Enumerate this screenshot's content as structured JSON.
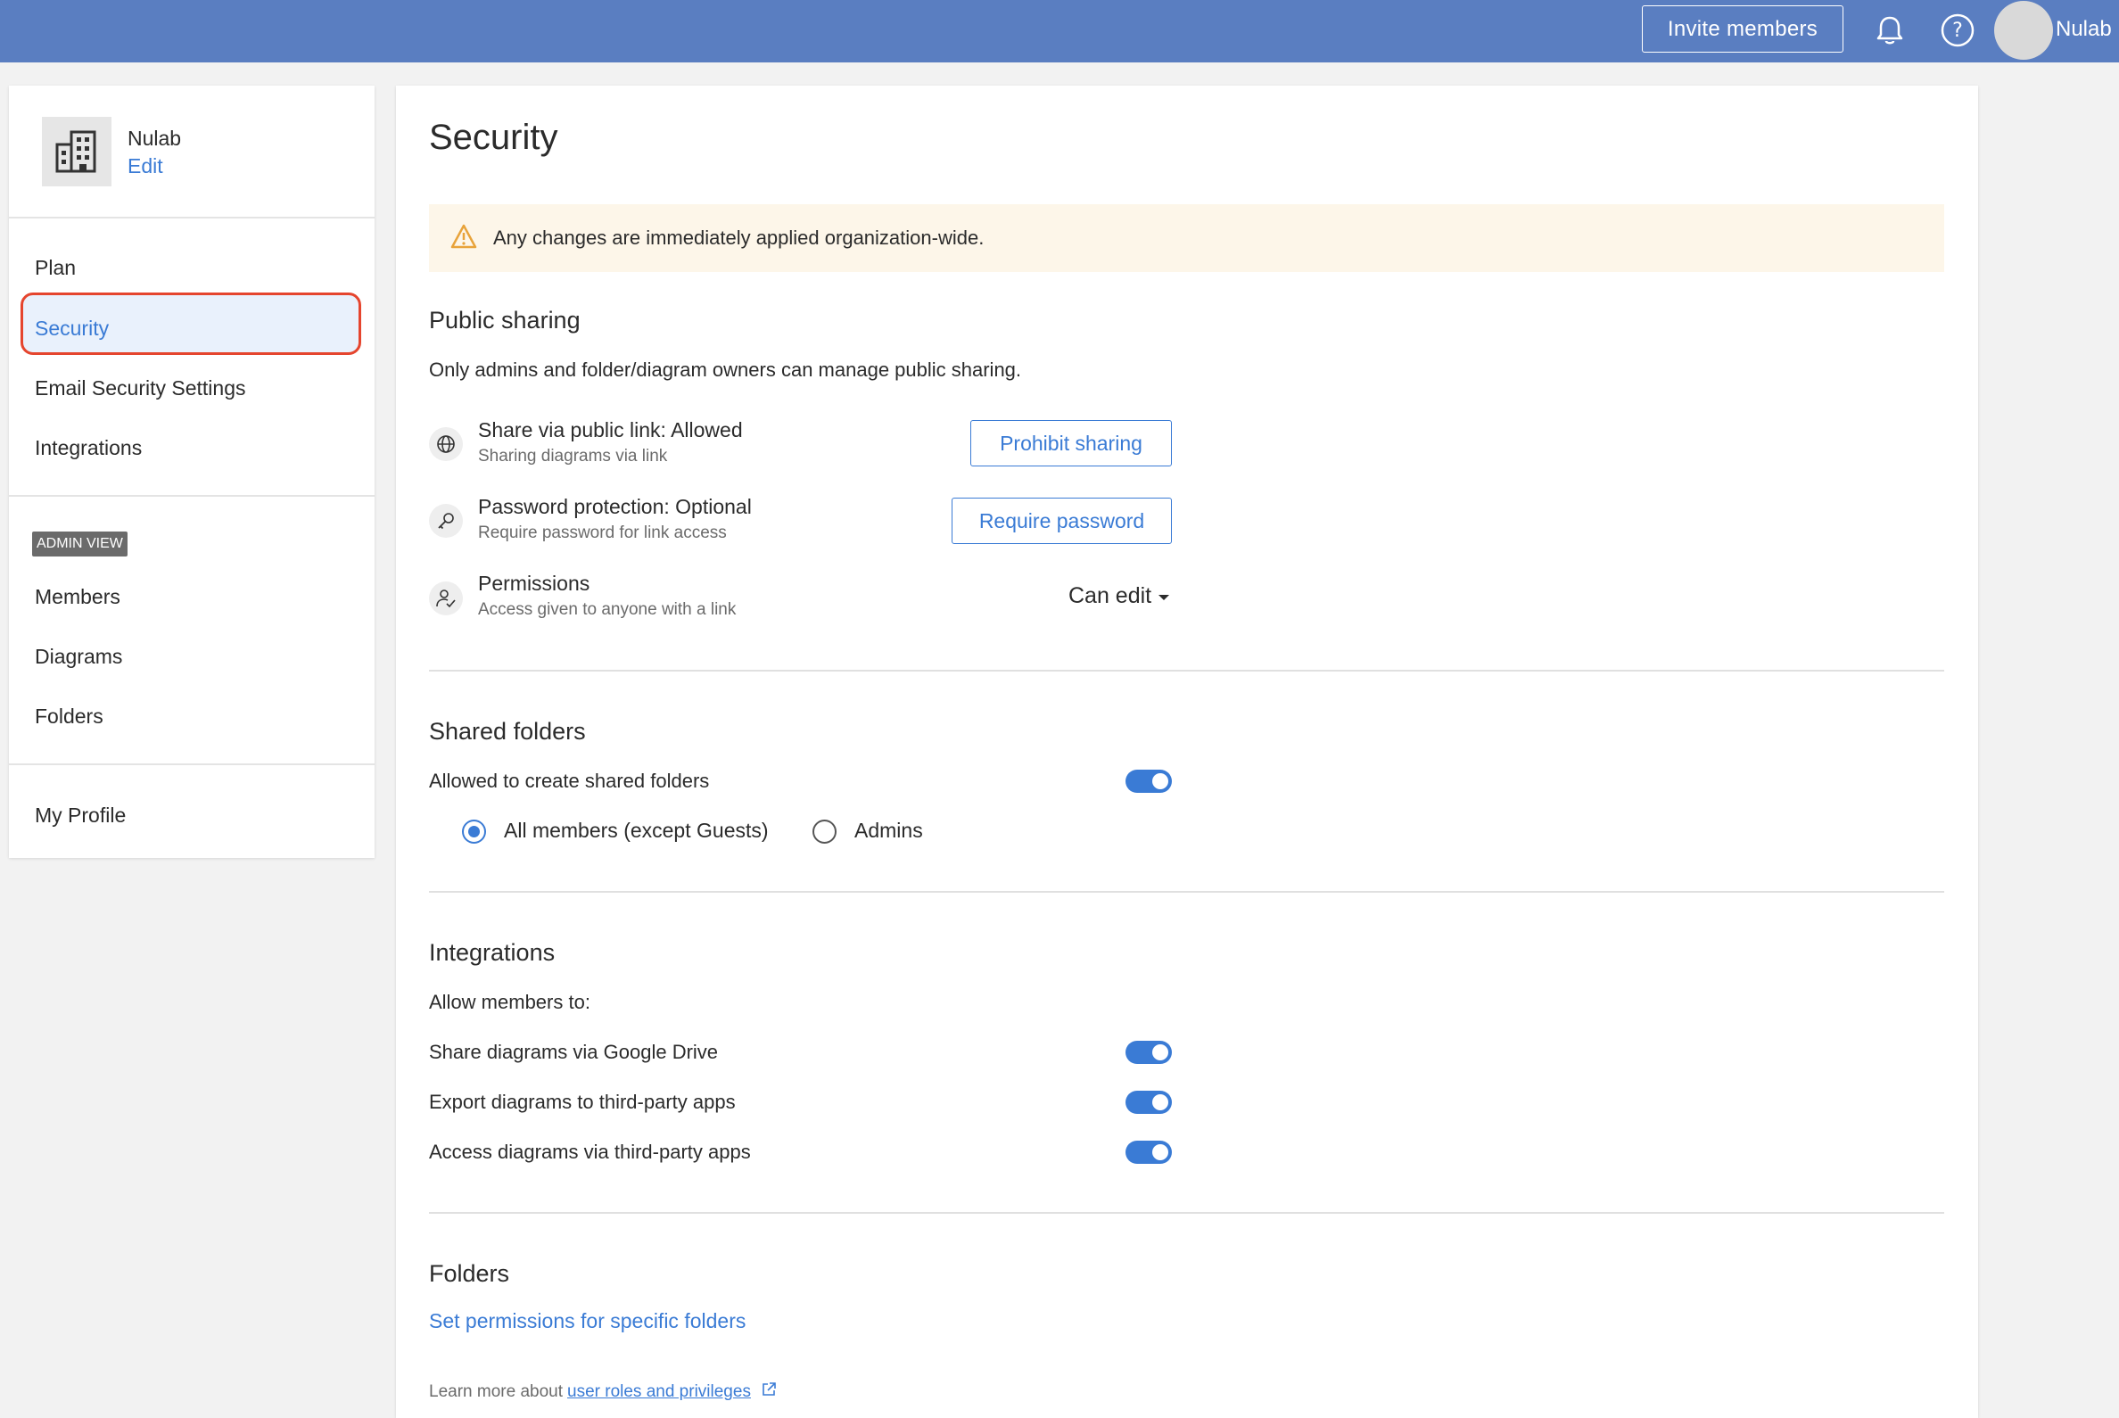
{
  "header": {
    "invite_label": "Invite members",
    "user_name": "Nulab"
  },
  "sidebar": {
    "org_name": "Nulab",
    "org_edit": "Edit",
    "items": [
      "Plan",
      "Security",
      "Email Security Settings",
      "Integrations"
    ],
    "admin_badge": "ADMIN VIEW",
    "admin_items": [
      "Members",
      "Diagrams",
      "Folders"
    ],
    "profile": "My Profile"
  },
  "main": {
    "title": "Security",
    "warning": "Any changes are immediately applied organization-wide.",
    "public_sharing": {
      "title": "Public sharing",
      "desc": "Only admins and folder/diagram owners can manage public sharing.",
      "options": [
        {
          "title": "Share via public link: Allowed",
          "sub": "Sharing diagrams via link",
          "button": "Prohibit sharing"
        },
        {
          "title": "Password protection: Optional",
          "sub": "Require password for link access",
          "button": "Require password"
        },
        {
          "title": "Permissions",
          "sub": "Access given to anyone with a link",
          "select": "Can edit"
        }
      ]
    },
    "shared_folders": {
      "title": "Shared folders",
      "label": "Allowed to create shared folders",
      "toggle_on": true,
      "radio_options": [
        "All members (except Guests)",
        "Admins"
      ],
      "radio_selected": "All members (except Guests)"
    },
    "integrations": {
      "title": "Integrations",
      "allow_label": "Allow members to:",
      "items": [
        {
          "label": "Share diagrams via Google Drive",
          "on": true
        },
        {
          "label": "Export diagrams to third-party apps",
          "on": true
        },
        {
          "label": "Access diagrams via third-party apps",
          "on": true
        }
      ]
    },
    "folders": {
      "title": "Folders",
      "link": "Set permissions for specific folders"
    },
    "learn_more": {
      "prefix": "Learn more about",
      "link": "user roles and privileges"
    }
  },
  "colors": {
    "topbar": "#5a7ec1",
    "accent": "#3a7bd5",
    "highlight_ring": "#e5452e",
    "warning_bg": "#fdf6e9"
  }
}
